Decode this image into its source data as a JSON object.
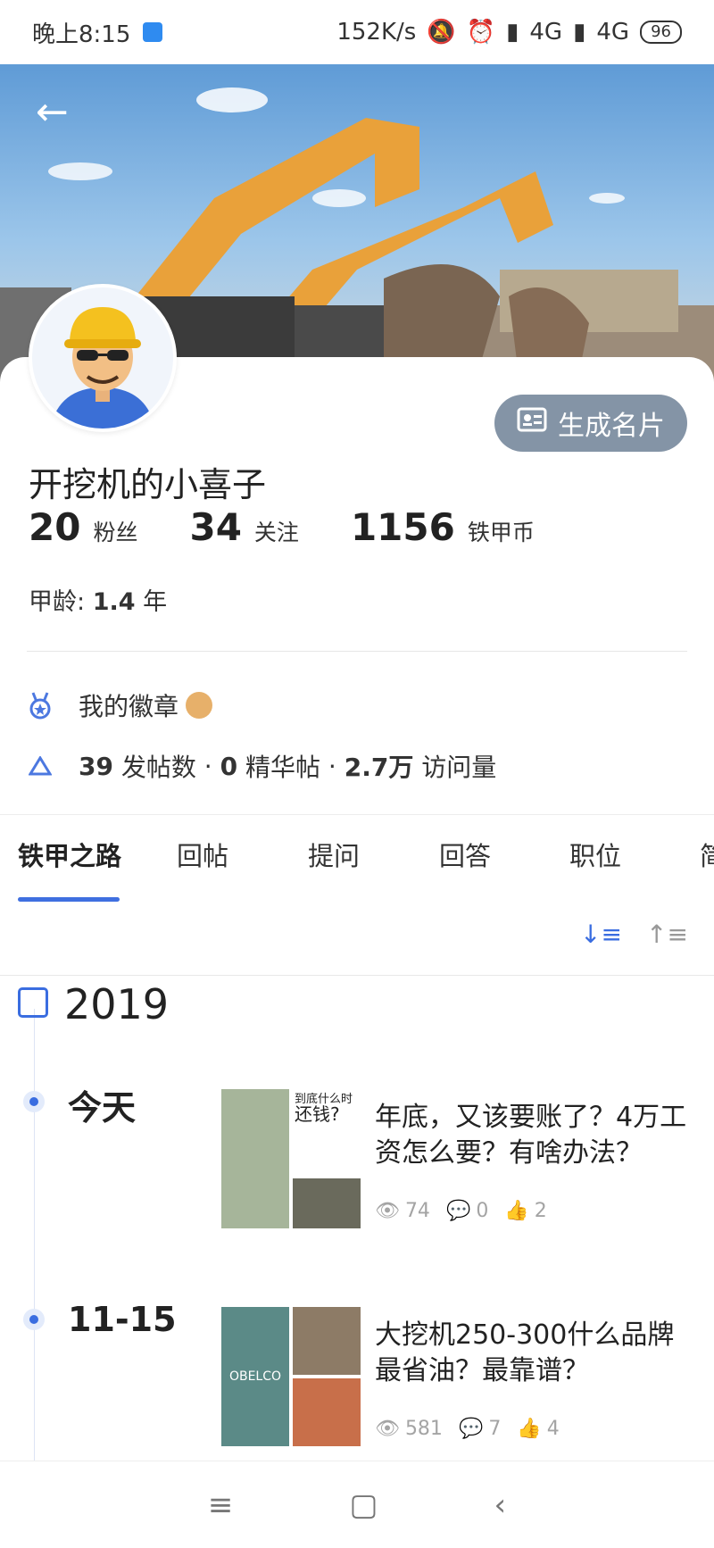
{
  "status_bar": {
    "time": "晚上8:15",
    "speed": "152K/s",
    "net1": "4G",
    "net2": "4G",
    "battery": "96"
  },
  "profile": {
    "name": "开挖机的小喜子",
    "generate_card": "生成名片",
    "fans": {
      "value": "20",
      "label": "粉丝"
    },
    "following": {
      "value": "34",
      "label": "关注"
    },
    "coins": {
      "value": "1156",
      "label": "铁甲币"
    },
    "age_label": "甲龄:",
    "age_value": "1.4",
    "age_unit": "年"
  },
  "badges": {
    "label": "我的徽章"
  },
  "post_stats": {
    "posts_value": "39",
    "posts_label": "发帖数",
    "featured_value": "0",
    "featured_label": "精华帖",
    "visits_value": "2.7万",
    "visits_label": "访问量",
    "sep": "·"
  },
  "tabs": [
    {
      "label": "铁甲之路"
    },
    {
      "label": "回帖"
    },
    {
      "label": "提问"
    },
    {
      "label": "回答"
    },
    {
      "label": "职位"
    },
    {
      "label": "简"
    }
  ],
  "timeline": {
    "year": "2019",
    "items": [
      {
        "date": "今天",
        "thumb_text_1": "到底什么时",
        "thumb_text_2": "还钱?",
        "title": "年底，又该要账了？4万工资怎么要？有啥办法？",
        "views": "74",
        "comments": "0",
        "likes": "2"
      },
      {
        "date": "11-15",
        "thumb_text_1": "OBELCO",
        "title": "大挖机250-300什么品牌最省油？最靠谱？",
        "views": "581",
        "comments": "7",
        "likes": "4"
      }
    ]
  },
  "colors": {
    "accent": "#3a6de0",
    "button_bg": "#8494a6",
    "excavator": "#e9a13a"
  }
}
